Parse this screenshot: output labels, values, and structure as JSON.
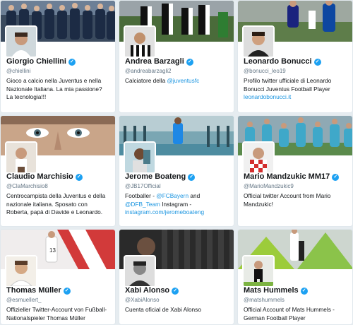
{
  "verified_glyph": "✓",
  "colors": {
    "link": "#1b95e0",
    "verified": "#1da1f2",
    "text": "#14171a",
    "muted": "#657786"
  },
  "cards": [
    {
      "name": "Giorgio Chiellini",
      "handle": "@chiellini",
      "bio": "Gioco a calcio nella Juventus e nella Nazionale Italiana. La mia passione? La tecnologia!!!"
    },
    {
      "name": "Andrea Barzagli",
      "handle": "@andreabarzagli2",
      "bio_prefix": "Calciatore della ",
      "bio_link": "@juventusfc"
    },
    {
      "name": "Leonardo Bonucci",
      "handle": "@bonucci_leo19",
      "bio": "Profilo twitter ufficiale di Leonardo Bonucci Juventus Football Player",
      "bio_link": "leonardobonucci.it"
    },
    {
      "name": "Claudio Marchisio",
      "handle": "@ClaMarchisio8",
      "bio": "Centrocampista della Juventus e della nazionale italiana. Sposato con Roberta, papà di Davide e Leonardo."
    },
    {
      "name": "Jerome Boateng",
      "handle": "@JB17Official",
      "bio_l1_prefix": "Footballer - ",
      "bio_l1_link": "@FCBayern",
      "bio_l1_suffix": " and",
      "bio_l2_link": "@DFB_Team",
      "bio_l2_suffix": " Instagram -",
      "bio_l3_link": "instagram.com/jeromeboateng"
    },
    {
      "name": "Mario Mandzukic MM17",
      "handle": "@MarioMandzukic9",
      "bio": "Official twitter Account from Mario Mandzukic!"
    },
    {
      "name": "Thomas Müller",
      "handle": "@esmuellert_",
      "bio": "Offizieller Twitter-Account von Fußball-Nationalspieler Thomas Müller"
    },
    {
      "name": "Xabi Alonso",
      "handle": "@XabiAlonso",
      "bio": "Cuenta oficial de Xabi Alonso"
    },
    {
      "name": "Mats Hummels",
      "handle": "@matshummels",
      "bio": "Official Account of Mats Hummels - German Football Player"
    }
  ]
}
